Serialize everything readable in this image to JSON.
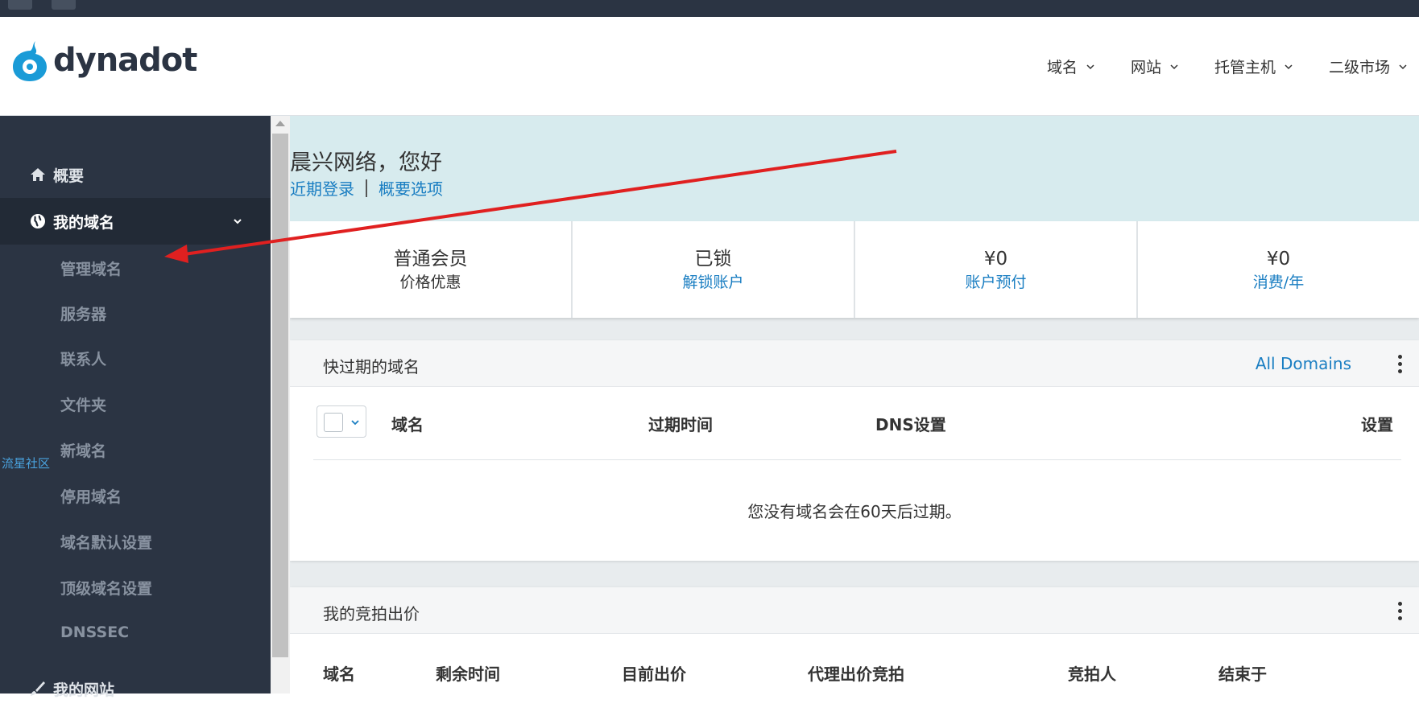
{
  "brand": {
    "name": "dynadot"
  },
  "nav": [
    {
      "label": "域名"
    },
    {
      "label": "网站"
    },
    {
      "label": "托管主机"
    },
    {
      "label": "二级市场"
    }
  ],
  "sidebar": {
    "overview": "概要",
    "my_domains": "我的域名",
    "sub_items": [
      "管理域名",
      "服务器",
      "联系人",
      "文件夹",
      "新域名",
      "停用域名",
      "域名默认设置",
      "顶级域名设置",
      "DNSSEC"
    ],
    "my_sites": "我的网站"
  },
  "watermark": "流星社区",
  "welcome": {
    "greeting": "晨兴网络，您好",
    "recent_login": "近期登录",
    "overview_options": "概要选项"
  },
  "stats": [
    {
      "value": "普通会员",
      "sub": "价格优惠"
    },
    {
      "value": "已锁",
      "sub": "解锁账户"
    },
    {
      "value": "¥0",
      "sub": "账户预付"
    },
    {
      "value": "¥0",
      "sub": "消费/年"
    }
  ],
  "expiring": {
    "title": "快过期的域名",
    "all_link": "All Domains",
    "columns": {
      "domain": "域名",
      "expire": "过期时间",
      "dns": "DNS设置",
      "settings": "设置"
    },
    "empty": "您没有域名会在60天后过期。"
  },
  "bids": {
    "title": "我的竞拍出价",
    "columns": [
      "域名",
      "剩余时间",
      "目前出价",
      "代理出价竞拍",
      "竞拍人",
      "结束于"
    ]
  },
  "colors": {
    "sidebar": "#2b3443",
    "link": "#1a7ec2",
    "welcome_bg": "#d7ebee",
    "arrow": "#e02020",
    "logo": "#1a9bd7"
  }
}
